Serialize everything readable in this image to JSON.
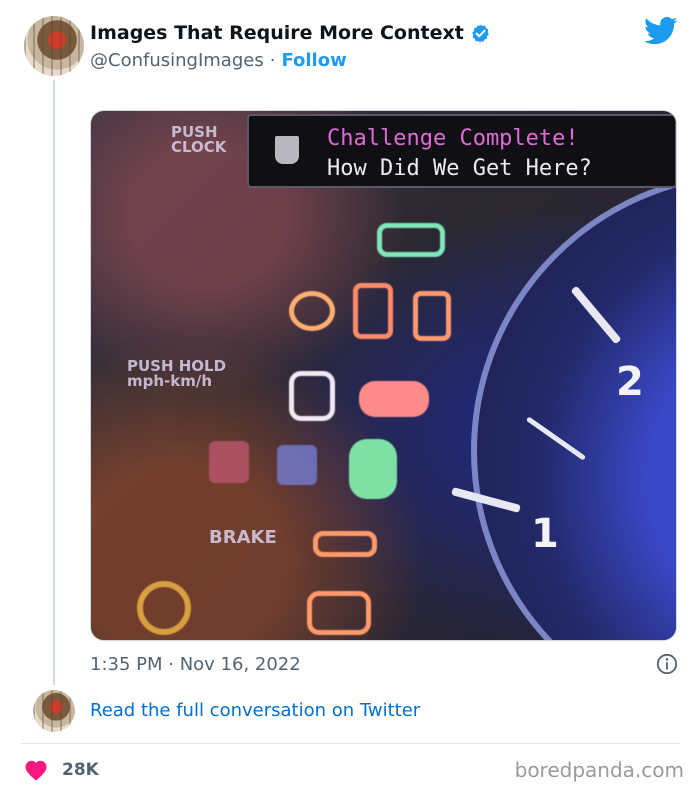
{
  "tweet": {
    "display_name": "Images That Require More Context",
    "handle": "@ConfusingImages",
    "separator": "·",
    "follow_label": "Follow",
    "timestamp": "1:35 PM · Nov 16, 2022",
    "read_more_label": "Read the full conversation on Twitter",
    "likes": "28K"
  },
  "media": {
    "banner_title": "Challenge Complete!",
    "banner_subtitle": "How Did We Get Here?",
    "dash_push_clock": "PUSH\nCLOCK",
    "dash_push_hold": "PUSH HOLD\nmph-km/h",
    "dash_brake": "BRAKE",
    "gauge_2": "2",
    "gauge_1": "1"
  },
  "watermark": "boredpanda.com",
  "colors": {
    "accent": "#1d9bf0",
    "link": "#006fd6",
    "heart": "#f91880"
  },
  "icons": [
    "verified-icon",
    "twitter-bird-icon",
    "info-icon",
    "heart-icon"
  ]
}
